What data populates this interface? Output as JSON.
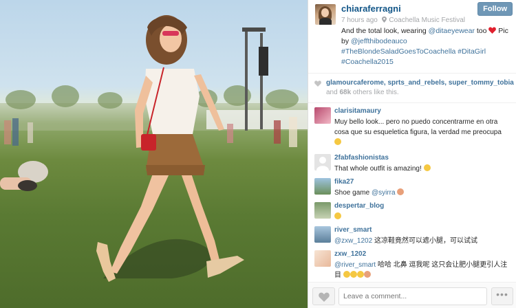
{
  "post": {
    "username": "chiaraferragni",
    "follow_label": "Follow",
    "time_ago": "7 hours ago",
    "separator": " · ",
    "location": "Coachella Music Festival",
    "caption": {
      "t1": "And the total look, wearing ",
      "mention1": "@ditaeyewear",
      "t2": " too ",
      "t3": " Pic by ",
      "mention2": "@jeffthibodeauco",
      "hashtags": "#TheBlondeSaladGoesToCoachella #DitaGirl #Coachella2015"
    }
  },
  "likes": {
    "names": "glamourcaferome, sprts_and_rebels, super_tommy_tobia",
    "others_prefix": "and ",
    "count": "68k",
    "others_suffix": " others like this."
  },
  "comments": [
    {
      "user": "clarisitamaury",
      "text": "Muy bello look... pero no puedo concentrarme en otra cosa que su esqueletica figura, la verdad me preocupa"
    },
    {
      "user": "2fabfashionistas",
      "text": "That whole outfit is amazing!"
    },
    {
      "user": "fika27",
      "text_pre": "Shoe game ",
      "mention": "@syirra"
    },
    {
      "user": "despertar_blog",
      "text": ""
    },
    {
      "user": "river_smart",
      "mention": "@zxw_1202",
      "text_post": " 这凉鞋竟然可以遮小腿，可以试试"
    },
    {
      "user": "zxw_1202",
      "mention": "@river_smart",
      "text_post": " 哈哈 北鼻 逗我呢 这只会让肥小腿更引人注目"
    }
  ],
  "footer": {
    "comment_placeholder": "Leave a comment...",
    "more_label": "•••"
  },
  "colors": {
    "link": "#3f729b",
    "username": "#125688",
    "follow_button": "#6f97b6",
    "muted": "#a5a7aa"
  }
}
